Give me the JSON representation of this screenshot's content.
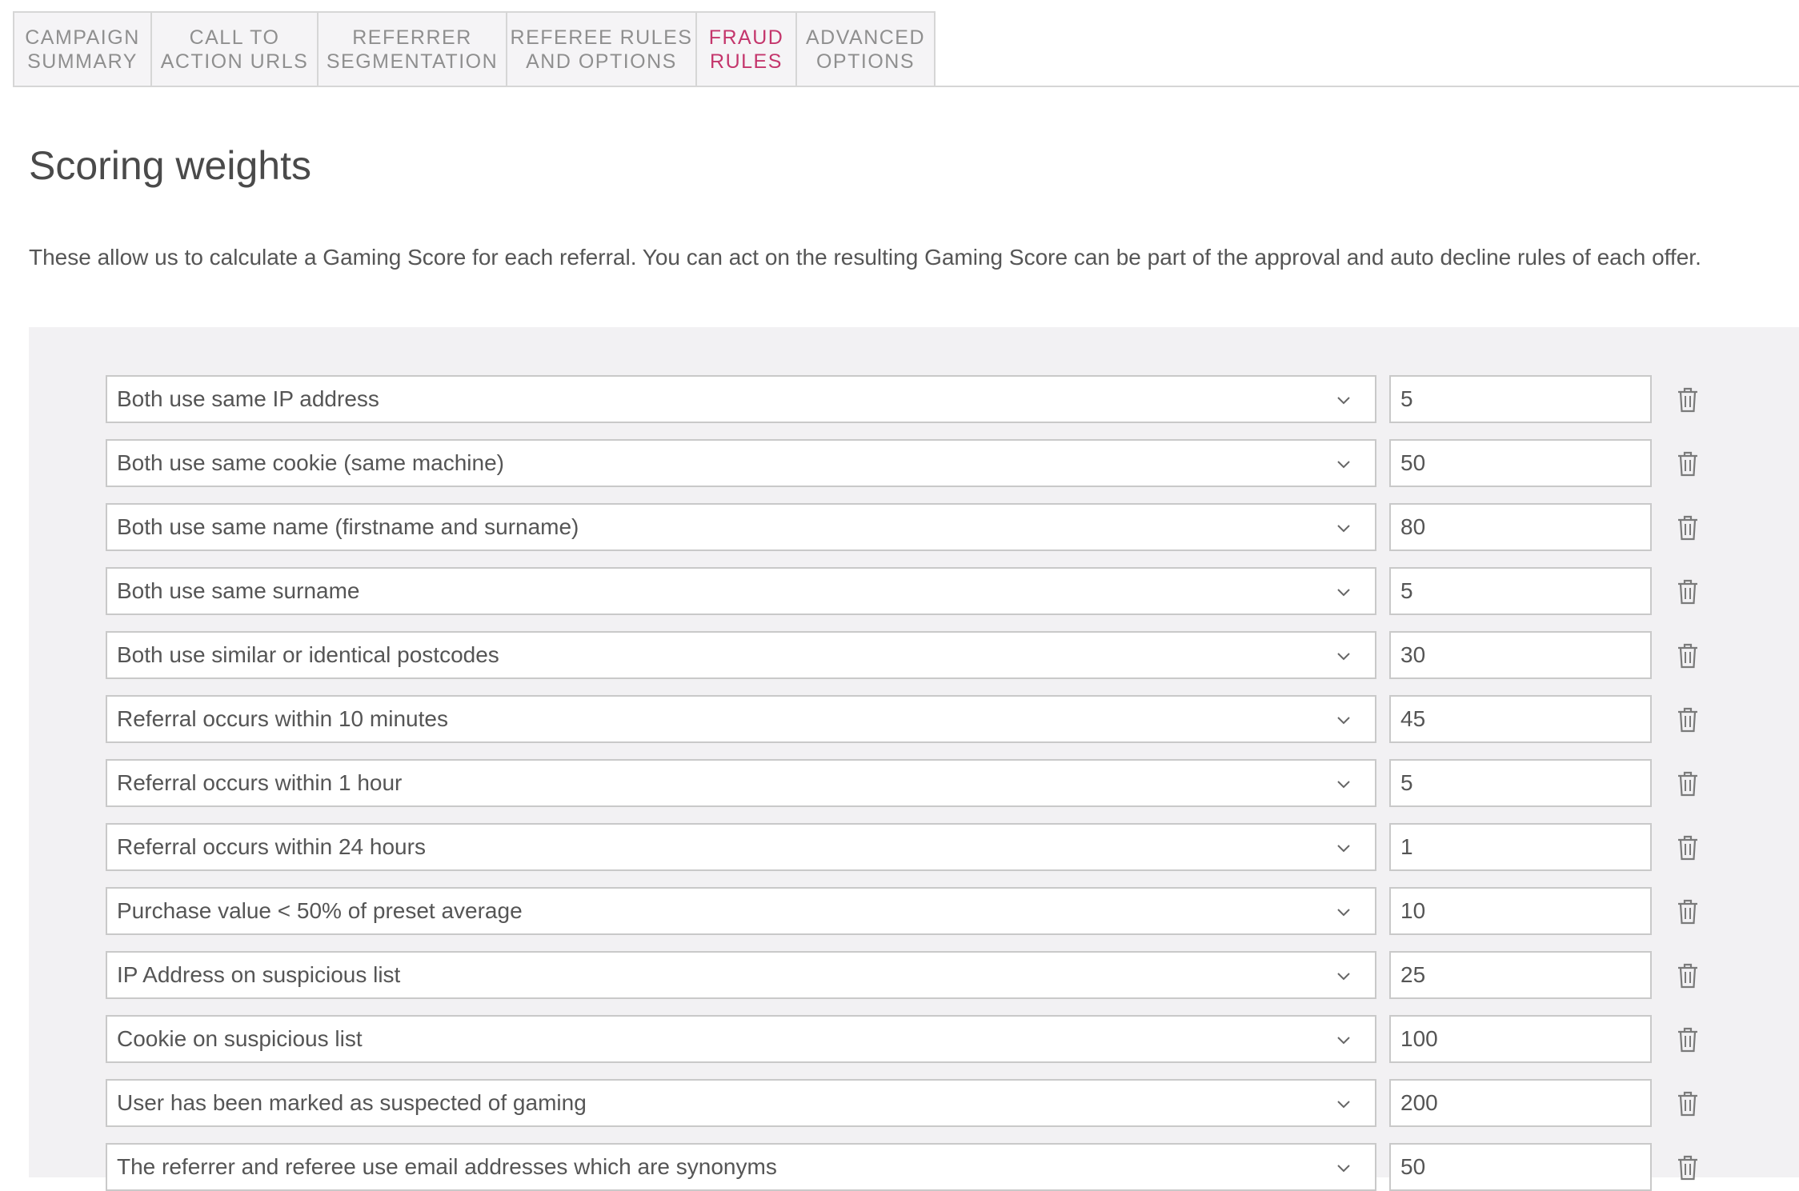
{
  "tabs": [
    {
      "label": "CAMPAIGN\nSUMMARY",
      "active": false
    },
    {
      "label": "CALL TO\nACTION URLS",
      "active": false
    },
    {
      "label": "REFERRER\nSEGMENTATION",
      "active": false
    },
    {
      "label": "REFEREE RULES\nAND OPTIONS",
      "active": false
    },
    {
      "label": "FRAUD\nRULES",
      "active": true
    },
    {
      "label": "ADVANCED\nOPTIONS",
      "active": false
    }
  ],
  "page": {
    "title": "Scoring weights",
    "description": "These allow us to calculate a Gaming Score for each referral. You can act on the resulting Gaming Score can be part of the approval and auto decline rules of each offer."
  },
  "rules": [
    {
      "label": "Both use same IP address",
      "weight": "5"
    },
    {
      "label": "Both use same cookie (same machine)",
      "weight": "50"
    },
    {
      "label": "Both use same name (firstname and surname)",
      "weight": "80"
    },
    {
      "label": "Both use same surname",
      "weight": "5"
    },
    {
      "label": "Both use similar or identical postcodes",
      "weight": "30"
    },
    {
      "label": "Referral occurs within 10 minutes",
      "weight": "45"
    },
    {
      "label": "Referral occurs within 1 hour",
      "weight": "5"
    },
    {
      "label": "Referral occurs within 24 hours",
      "weight": "1"
    },
    {
      "label": "Purchase value < 50% of preset average",
      "weight": "10"
    },
    {
      "label": "IP Address on suspicious list",
      "weight": "25"
    },
    {
      "label": "Cookie on suspicious list",
      "weight": "100"
    },
    {
      "label": "User has been marked as suspected of gaming",
      "weight": "200"
    },
    {
      "label": "The referrer and referee use email addresses which are synonyms",
      "weight": "50"
    }
  ],
  "icons": {
    "dropdown": "chevron-down-icon",
    "delete": "trash-icon"
  },
  "colors": {
    "active_tab": "#c4366c",
    "panel_background": "#f2f1f3"
  }
}
